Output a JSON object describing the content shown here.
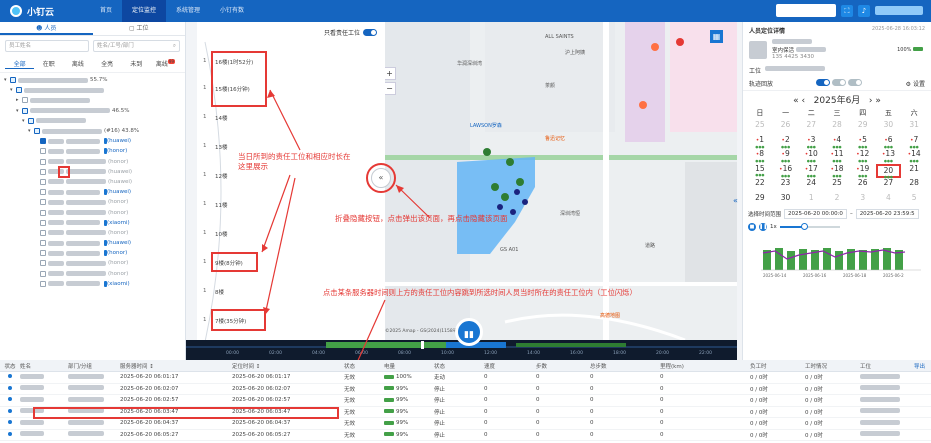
{
  "app": {
    "name": "小钉云"
  },
  "nav": [
    "首页",
    "定位监控",
    "系统管理",
    "小钉有数"
  ],
  "left": {
    "tabs": [
      "人员",
      "工位"
    ],
    "filter_placeholder": "员工姓名",
    "search_placeholder": "姓名/工号/部门",
    "status_tabs": [
      "全部",
      "在职",
      "离线",
      "全亮",
      "未到",
      "离线"
    ],
    "badge": "99",
    "tree_percent": [
      "55.7%",
      "46.5%",
      "(#16) 43.8%"
    ],
    "members": [
      "(huawei)",
      "(honor)",
      "(honor)",
      "(huawei)",
      "(huawei)",
      "(huawei)",
      "(honor)",
      "(honor)",
      "(xiaomi)",
      "(honor)",
      "(huawei)",
      "(honor)",
      "(honor)",
      "(honor)",
      "(xiaomi)"
    ]
  },
  "floors": {
    "toggle_label": "只看责任工位",
    "items": [
      {
        "n": "1",
        "label": "16楼(1时52分)"
      },
      {
        "n": "1",
        "label": "15楼(16分钟)"
      },
      {
        "n": "1",
        "label": "14楼"
      },
      {
        "n": "1",
        "label": "13楼"
      },
      {
        "n": "1",
        "label": "12楼"
      },
      {
        "n": "1",
        "label": "11楼"
      },
      {
        "n": "1",
        "label": "10楼"
      },
      {
        "n": "1",
        "label": "9楼(8分钟)"
      },
      {
        "n": "1",
        "label": "8楼"
      },
      {
        "n": "1",
        "label": "7楼(35分钟)"
      }
    ]
  },
  "annotations": {
    "a1": "当日所到的责任工位和相应时长在这里展示",
    "a2": "折叠隐藏按钮，点击弹出该页面，再点击隐藏该页面",
    "a3": "点击某条服务器时间则上方的责任工位内容跳到所选时间人员当时所在的责任工位内（工位闪烁）"
  },
  "map": {
    "labels": [
      "华润深圳湾",
      "ALL SAINTS",
      "沪上阿姨",
      "茶颜",
      "LAWSON罗森",
      "鲁迅记忆",
      "深圳湾恒",
      "高德地图",
      "道路",
      "GS A01"
    ],
    "copyright": "©2025 Amap - GS(2024)1158号",
    "timeline_ticks": [
      "00:00",
      "02:00",
      "04:00",
      "06:00",
      "08:00",
      "10:00",
      "12:00",
      "14:00",
      "16:00",
      "18:00",
      "20:00",
      "22:00"
    ]
  },
  "right": {
    "title": "人员定位详情",
    "date": "2025-06-28 16:03:12",
    "battery": "100%",
    "room": "室内保活",
    "phone": "135 4425 3430",
    "workpos_label": "工位",
    "track_label": "轨迹回放",
    "settings_label": "设置",
    "month_title": "2025年6月",
    "weekdays": [
      "日",
      "一",
      "二",
      "三",
      "四",
      "五",
      "六"
    ],
    "time_label": "选择时间范围",
    "time_start": "2025-06-20 00:00:0",
    "time_end": "2025-06-20 23:59:5",
    "speed": "1x",
    "chart_labels": [
      "2025-06-14",
      "2025-06-16",
      "2025-06-18",
      "2025-06-2"
    ]
  },
  "table": {
    "headers": [
      "状态",
      "姓名",
      "部门/分组",
      "服务器时间",
      "定位时间",
      "状态",
      "电量",
      "状态",
      "速度",
      "步数",
      "总步数",
      "里程(km)",
      "负工时",
      "工时情况",
      "工位"
    ],
    "export_label": "导出",
    "rows": [
      {
        "server": "2025-06-20 06:01:17",
        "loc": "2025-06-20 06:01:17",
        "s1": "无效",
        "bat": "100%",
        "s2": "走动",
        "speed": "0",
        "steps": "0",
        "total": "0",
        "km": "0",
        "neg": "0 / 0时",
        "work": "0 / 0时"
      },
      {
        "server": "2025-06-20 06:02:07",
        "loc": "2025-06-20 06:02:07",
        "s1": "无效",
        "bat": "99%",
        "s2": "停止",
        "speed": "0",
        "steps": "0",
        "total": "0",
        "km": "0",
        "neg": "0 / 0时",
        "work": "0 / 0时"
      },
      {
        "server": "2025-06-20 06:02:57",
        "loc": "2025-06-20 06:02:57",
        "s1": "无效",
        "bat": "99%",
        "s2": "停止",
        "speed": "0",
        "steps": "0",
        "total": "0",
        "km": "0",
        "neg": "0 / 0时",
        "work": "0 / 0时"
      },
      {
        "server": "2025-06-20 06:03:47",
        "loc": "2025-06-20 06:03:47",
        "s1": "无效",
        "bat": "99%",
        "s2": "停止",
        "speed": "0",
        "steps": "0",
        "total": "0",
        "km": "0",
        "neg": "0 / 0时",
        "work": "0 / 0时"
      },
      {
        "server": "2025-06-20 06:04:37",
        "loc": "2025-06-20 06:04:37",
        "s1": "无效",
        "bat": "99%",
        "s2": "停止",
        "speed": "0",
        "steps": "0",
        "total": "0",
        "km": "0",
        "neg": "0 / 0时",
        "work": "0 / 0时"
      },
      {
        "server": "2025-06-20 06:05:27",
        "loc": "2025-06-20 06:05:27",
        "s1": "无效",
        "bat": "99%",
        "s2": "停止",
        "speed": "0",
        "steps": "0",
        "total": "0",
        "km": "0",
        "neg": "0 / 0时",
        "work": "0 / 0时"
      }
    ]
  }
}
